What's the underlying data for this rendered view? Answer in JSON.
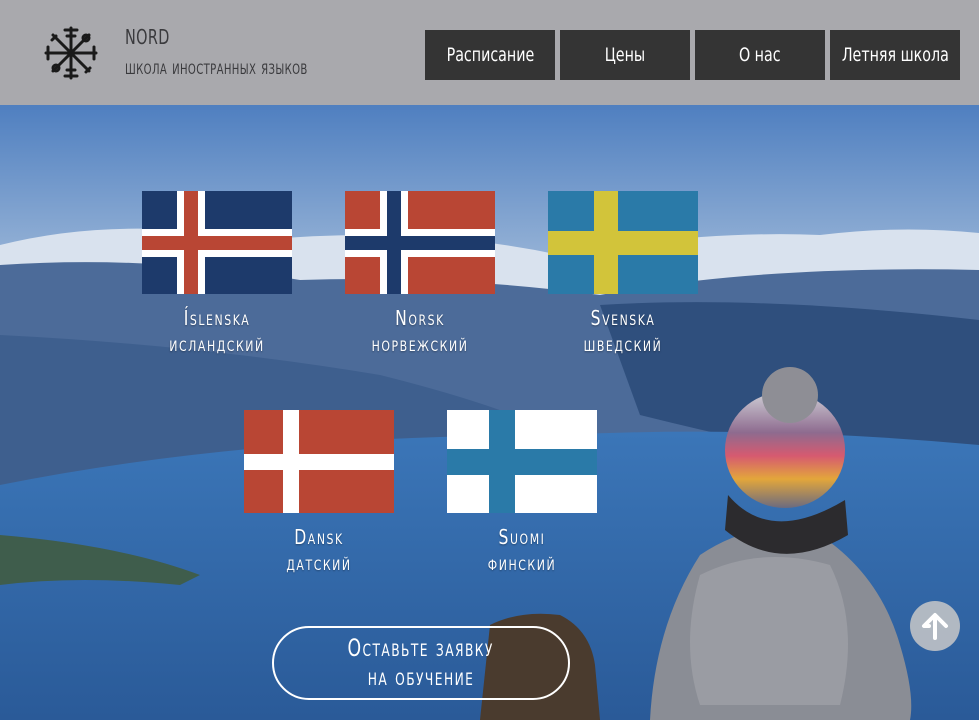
{
  "header": {
    "brand_name": "NORD",
    "brand_tagline": "школа иностранных языков",
    "logo_icon": "vegvisir-icon"
  },
  "nav": {
    "items": [
      {
        "label": "Расписание"
      },
      {
        "label": "Цены"
      },
      {
        "label": "О нас"
      },
      {
        "label": "Летняя школа"
      }
    ]
  },
  "languages": [
    {
      "native": "Íslenska",
      "russian": "исландский",
      "flag": "iceland-flag"
    },
    {
      "native": "Norsk",
      "russian": "норвежский",
      "flag": "norway-flag"
    },
    {
      "native": "Svenska",
      "russian": "шведский",
      "flag": "sweden-flag"
    },
    {
      "native": "Dansk",
      "russian": "датский",
      "flag": "denmark-flag"
    },
    {
      "native": "Suomi",
      "russian": "финский",
      "flag": "finland-flag"
    }
  ],
  "cta": {
    "line1": "Оставьте заявку",
    "line2": "на обучение"
  },
  "scroll_top_icon": "arrow-up-icon",
  "colors": {
    "header_bg": "#a9a9ad",
    "nav_bg": "#343434",
    "flag_red": "#b94634",
    "flag_blue": "#1d3a6b",
    "flag_light_blue": "#2a7aa8",
    "flag_yellow": "#d2c43a"
  }
}
